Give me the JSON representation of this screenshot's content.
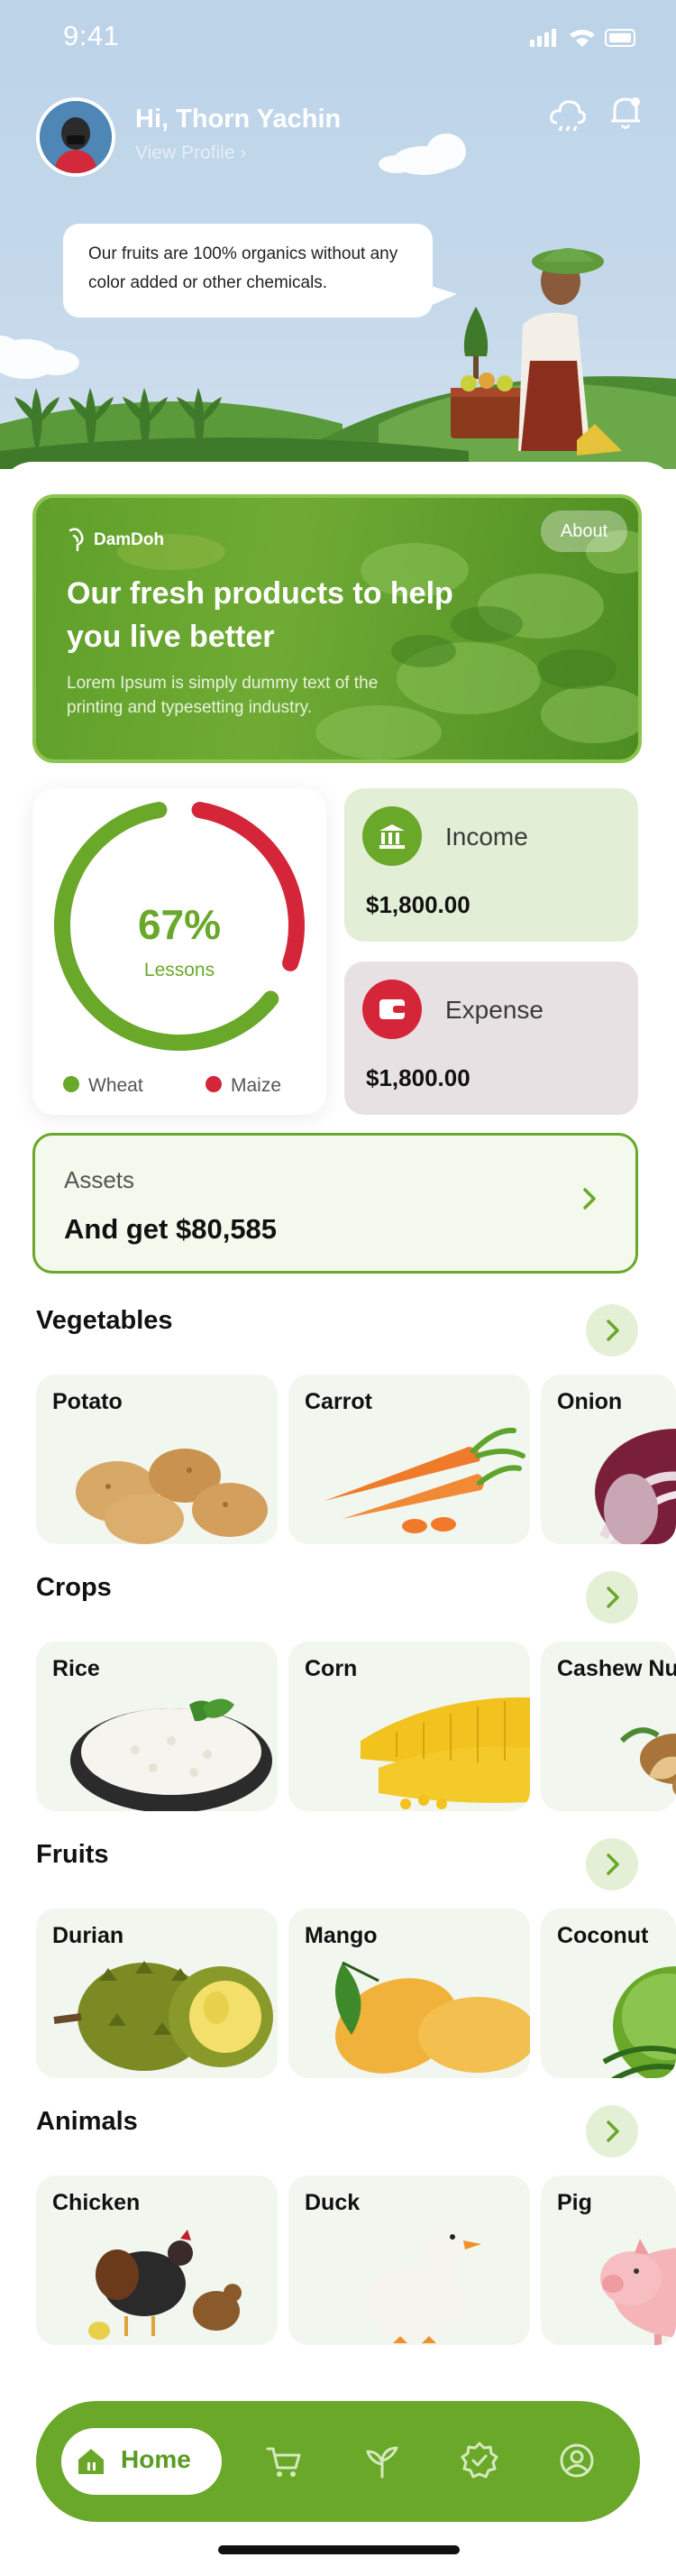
{
  "status_bar": {
    "time": "9:41"
  },
  "header": {
    "greeting": "Hi, Thorn Yachin",
    "view_profile": "View Profile  ›",
    "speech": "Our fruits are 100% organics without any color added or other chemicals."
  },
  "banner": {
    "brand": "DamDoh",
    "title": "Our fresh products  to help you live better",
    "description": "Lorem Ipsum is simply dummy text of the printing and typesetting industry.",
    "about_label": "About"
  },
  "lessons": {
    "percent_label": "67%",
    "caption": "Lessons",
    "progress": 0.67,
    "legend": [
      {
        "label": "Wheat",
        "color": "#6aa82a"
      },
      {
        "label": "Maize",
        "color": "#d42638"
      }
    ]
  },
  "income": {
    "label": "Income",
    "amount": "$1,800.00",
    "icon": "bank-icon",
    "color": "#6aa82a"
  },
  "expense": {
    "label": "Expense",
    "amount": "$1,800.00",
    "icon": "wallet-icon",
    "color": "#d42638"
  },
  "assets": {
    "label": "Assets",
    "value": "And get $80,585"
  },
  "sections": [
    {
      "title": "Vegetables",
      "items": [
        "Potato",
        "Carrot",
        "Onion"
      ]
    },
    {
      "title": "Crops",
      "items": [
        "Rice",
        "Corn",
        "Cashew Nut"
      ]
    },
    {
      "title": "Fruits",
      "items": [
        "Durian",
        "Mango",
        "Coconut"
      ]
    },
    {
      "title": "Animals",
      "items": [
        "Chicken",
        "Duck",
        "Pig"
      ]
    }
  ],
  "nav": {
    "home_label": "Home",
    "items": [
      "home-icon",
      "cart-icon",
      "leaf-icon",
      "badge-icon",
      "profile-icon"
    ]
  },
  "colors": {
    "accent": "#6aa82a",
    "danger": "#d42638",
    "sky": "#bcd3e8"
  }
}
